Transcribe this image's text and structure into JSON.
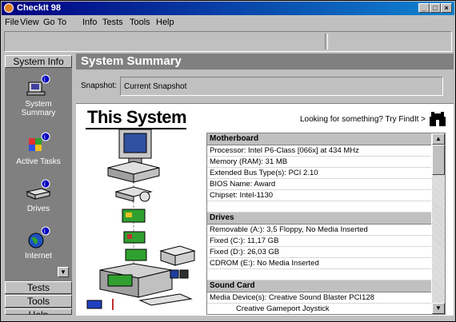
{
  "window": {
    "title": "CheckIt 98"
  },
  "menu": {
    "left": [
      "File",
      "View",
      "Go To"
    ],
    "right": [
      "Info",
      "Tests",
      "Tools",
      "Help"
    ]
  },
  "sidebar": {
    "top_category": "System Info",
    "items": [
      {
        "label": "System Summary",
        "icon": "system-summary-icon"
      },
      {
        "label": "Active Tasks",
        "icon": "active-tasks-icon"
      },
      {
        "label": "Drives",
        "icon": "drives-icon"
      },
      {
        "label": "Internet",
        "icon": "internet-icon"
      }
    ],
    "bottom_categories": [
      "Tests",
      "Tools",
      "Help"
    ]
  },
  "main": {
    "header": "System Summary",
    "snapshot_label": "Snapshot:",
    "snapshot_value": "Current Snapshot",
    "banner_title": "This System",
    "findit": "Looking for something? Try FindIt >"
  },
  "info": {
    "motherboard_header": "Motherboard",
    "motherboard": [
      "Processor:  Intel P6-Class [066x] at 434 MHz",
      "Memory (RAM):  31 MB",
      "Extended Bus Type(s):  PCI 2.10",
      "BIOS Name:  Award",
      "Chipset:  Intel-1130"
    ],
    "drives_header": "Drives",
    "drives": [
      "Removable (A:):  3,5 Floppy, No Media Inserted",
      "Fixed (C:):  11,17 GB",
      "Fixed (D:):  26,03 GB",
      "CDROM (E:):  No Media Inserted"
    ],
    "sound_header": "Sound Card",
    "sound": [
      "Media Device(s):  Creative Sound Blaster PCI128"
    ],
    "sound_indent": "Creative Gameport Joystick"
  },
  "colors": {
    "titlebar": "#000080",
    "face": "#c0c0c0",
    "shadow": "#808080"
  }
}
